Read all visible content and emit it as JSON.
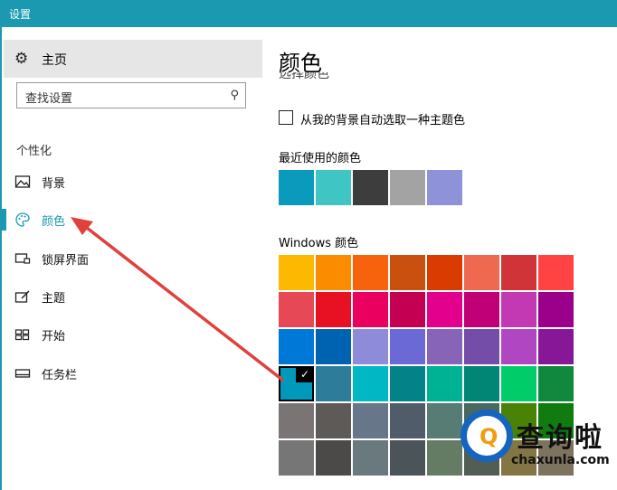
{
  "window": {
    "title": "设置"
  },
  "sidebar": {
    "home": {
      "icon": "gear-icon",
      "label": "主页"
    },
    "search": {
      "placeholder": "查找设置",
      "icon": "search-icon"
    },
    "section": "个性化",
    "items": [
      {
        "icon": "picture-icon",
        "label": "背景",
        "active": false
      },
      {
        "icon": "palette-icon",
        "label": "颜色",
        "active": true
      },
      {
        "icon": "lock-screen-icon",
        "label": "锁屏界面",
        "active": false
      },
      {
        "icon": "theme-icon",
        "label": "主题",
        "active": false
      },
      {
        "icon": "start-icon",
        "label": "开始",
        "active": false
      },
      {
        "icon": "taskbar-icon",
        "label": "任务栏",
        "active": false
      }
    ]
  },
  "main": {
    "title": "颜色",
    "partial_heading": "选择颜色",
    "auto_pick_label": "从我的背景自动选取一种主题色",
    "auto_pick_checked": false,
    "recent_label": "最近使用的颜色",
    "recent_colors": [
      "#0a9bbc",
      "#3fc6c4",
      "#3d3d3d",
      "#a3a3a3",
      "#8e92d8"
    ],
    "windows_label": "Windows 颜色",
    "windows_colors": [
      [
        "#fdb902",
        "#fb8c00",
        "#f7630c",
        "#ca5010",
        "#da3b01",
        "#ef6950",
        "#d13438",
        "#ff4343"
      ],
      [
        "#e74856",
        "#e81123",
        "#ea005e",
        "#c30052",
        "#e3008c",
        "#bf0077",
        "#c239b3",
        "#9a0089"
      ],
      [
        "#0078d7",
        "#0063b1",
        "#8e8cd8",
        "#6b69d6",
        "#8764b8",
        "#744da9",
        "#b146c2",
        "#881798"
      ],
      [
        "#0099bc",
        "#2d7d9a",
        "#00b7c3",
        "#038387",
        "#00b294",
        "#018574",
        "#00cc6a",
        "#10893e"
      ],
      [
        "#7a7574",
        "#5d5a58",
        "#68768a",
        "#515c6b",
        "#567c73",
        "#486860",
        "#498205",
        "#107c10"
      ],
      [
        "#767676",
        "#4c4a48",
        "#69797e",
        "#4a5459",
        "#647c64",
        "#525e54",
        "#847545",
        "#7e735f"
      ]
    ],
    "selected": {
      "row": 3,
      "col": 0
    }
  },
  "watermark": {
    "brand_cn": "查询啦",
    "brand_en": "chaxunla.com"
  },
  "colors": {
    "accent": "#1b99b1",
    "arrow": "#e0413b"
  }
}
